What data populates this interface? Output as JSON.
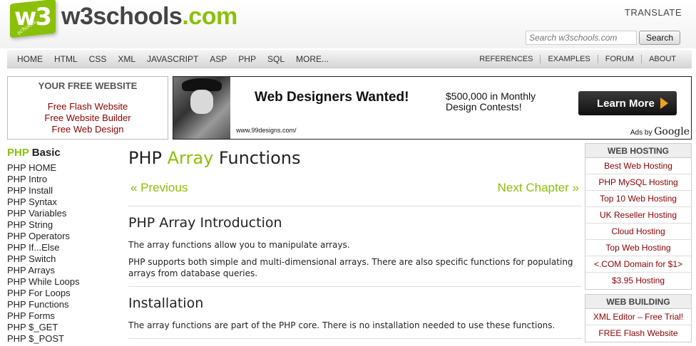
{
  "header": {
    "logo_text": "w3schools",
    "logo_tld": ".com",
    "logo_badge": "w3",
    "logo_badge_small": "schools",
    "translate": "TRANSLATE",
    "search_placeholder": "Search w3schools.com",
    "search_button": "Search"
  },
  "nav": {
    "left": [
      "HOME",
      "HTML",
      "CSS",
      "XML",
      "JAVASCRIPT",
      "ASP",
      "PHP",
      "SQL",
      "MORE..."
    ],
    "right": [
      "REFERENCES",
      "EXAMPLES",
      "FORUM",
      "ABOUT"
    ]
  },
  "free_box": {
    "title": "YOUR FREE WEBSITE",
    "links": [
      "Free Flash Website",
      "Free Website Builder",
      "Free Web Design"
    ]
  },
  "ad": {
    "headline": "Web Designers Wanted!",
    "money_line1": "$500,000 in Monthly",
    "money_line2": "Design Contests!",
    "button": "Learn More",
    "url": "www.99designs.com/",
    "ads_by": "Ads by",
    "google": "Google"
  },
  "sidebar": {
    "title_green": "PHP",
    "title_rest": " Basic",
    "items": [
      "PHP HOME",
      "PHP Intro",
      "PHP Install",
      "PHP Syntax",
      "PHP Variables",
      "PHP String",
      "PHP Operators",
      "PHP If...Else",
      "PHP Switch",
      "PHP Arrays",
      "PHP While Loops",
      "PHP For Loops",
      "PHP Functions",
      "PHP Forms",
      "PHP $_GET",
      "PHP $_POST"
    ]
  },
  "main": {
    "title_pre": "PHP ",
    "title_green": "Array",
    "title_post": " Functions",
    "prev": "« Previous",
    "next": "Next Chapter »",
    "intro_heading": "PHP Array Introduction",
    "intro_p1": "The array functions allow you to manipulate arrays.",
    "intro_p2": "PHP supports both simple and multi-dimensional arrays. There are also specific functions for populating arrays from database queries.",
    "install_heading": "Installation",
    "install_p1": "The array functions are part of the PHP core. There is no installation needed to use these functions."
  },
  "right": {
    "hosting_title": "WEB HOSTING",
    "hosting_items": [
      "Best Web Hosting",
      "PHP MySQL Hosting",
      "Top 10 Web Hosting",
      "UK Reseller Hosting",
      "Cloud Hosting",
      "Top Web Hosting",
      "<.COM Domain for $1>",
      "$3.95 Hosting"
    ],
    "building_title": "WEB BUILDING",
    "building_items": [
      "XML Editor – Free Trial!",
      "FREE Flash Website"
    ]
  },
  "colors": {
    "brand_green": "#8ac007",
    "link_red": "#8b0000"
  }
}
